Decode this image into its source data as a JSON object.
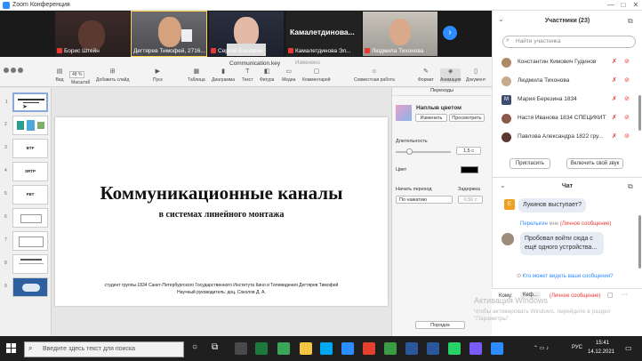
{
  "window": {
    "title": "Zoom Конференция"
  },
  "videos": [
    {
      "name": "Борис Штейн",
      "muted": true,
      "active": false
    },
    {
      "name": "Дегтярев Тимофей, 2716...",
      "muted": false,
      "active": true
    },
    {
      "name": "Сергей Башарин",
      "muted": true,
      "active": false
    },
    {
      "name": "Камалетдинова Эл...",
      "big_name": "Камалетдинова...",
      "muted": true,
      "active": false
    },
    {
      "name": "Людмила Тихонова",
      "muted": true,
      "active": false
    }
  ],
  "keynote": {
    "doc_name": "Communication.key",
    "doc_status": "Изменено",
    "toolbar": [
      "Вид",
      "Масштаб",
      "Добавить слайд",
      "Пуск",
      "Таблица",
      "Диаграмма",
      "Текст",
      "Фигура",
      "Медиа",
      "Комментарий",
      "Совместная работа",
      "Формат",
      "Анимация",
      "Документ"
    ],
    "zoom": "48 %",
    "slide_thumbs": [
      {
        "num": "1",
        "text": ""
      },
      {
        "num": "2",
        "text": ""
      },
      {
        "num": "3",
        "text": "BTF"
      },
      {
        "num": "4",
        "text": "SRTP"
      },
      {
        "num": "5",
        "text": "FBT"
      },
      {
        "num": "6",
        "text": ""
      },
      {
        "num": "7",
        "text": ""
      },
      {
        "num": "8",
        "text": ""
      },
      {
        "num": "9",
        "text": ""
      }
    ],
    "slide": {
      "title": "Коммуникационные каналы",
      "subtitle": "в системах линейного монтажа",
      "author": "студент группы 1834 Санкт-Петербургского Государственного Института Кино и Телевидения Дегтярев Тимофей",
      "advisor": "Научный руководитель: доц. Соколов Д. А."
    },
    "inspector": {
      "header": "Переходы",
      "effect": "Наплыв цветом",
      "change_btn": "Изменить",
      "preview_btn": "Просмотреть",
      "duration_label": "Длительность",
      "duration_value": "1,5 с",
      "color_label": "Цвет",
      "start_label": "Начать переход",
      "start_value": "По нажатию",
      "delay_label": "Задержка",
      "delay_value": "0,50 с",
      "order_btn": "Порядок"
    }
  },
  "participants": {
    "header": "Участники (23)",
    "search_placeholder": "Найти участника",
    "list": [
      {
        "name": "Константин Кимович Гудинов",
        "avatar": "photo"
      },
      {
        "name": "Людмила Тихонова",
        "avatar": "photo"
      },
      {
        "name": "Мария Березина 1834",
        "avatar": "M"
      },
      {
        "name": "Настя Иванова 1834 СПЕЦИКИТ",
        "avatar": "photo"
      },
      {
        "name": "Павлова Александра 1822 гру...",
        "avatar": "photo"
      }
    ],
    "invite_btn": "Пригласить",
    "unmute_btn": "Включить свой звук"
  },
  "chat": {
    "header": "Чат",
    "msg1_avatar": "Е",
    "msg1": "Лукинов выступает?",
    "sender2": "Перелыгин",
    "sender2_to": "мне",
    "sender2_private": "(Личное сообщение)",
    "msg2": "Пробовал войти сюда с ещё одного устройства...",
    "who_can_see": "Кто может видеть ваши сообщения?",
    "to_label": "Кому:",
    "to_value": "Кеф...",
    "to_private": "(Личное сообщение)"
  },
  "activation": {
    "title": "Активация Windows",
    "text": "Чтобы активировать Windows, перейдите в раздел \"Параметры\"."
  },
  "taskbar": {
    "search_placeholder": "Введите здесь текст для поиска",
    "lang": "РУС",
    "time": "15:41",
    "date": "14.12.2021"
  }
}
